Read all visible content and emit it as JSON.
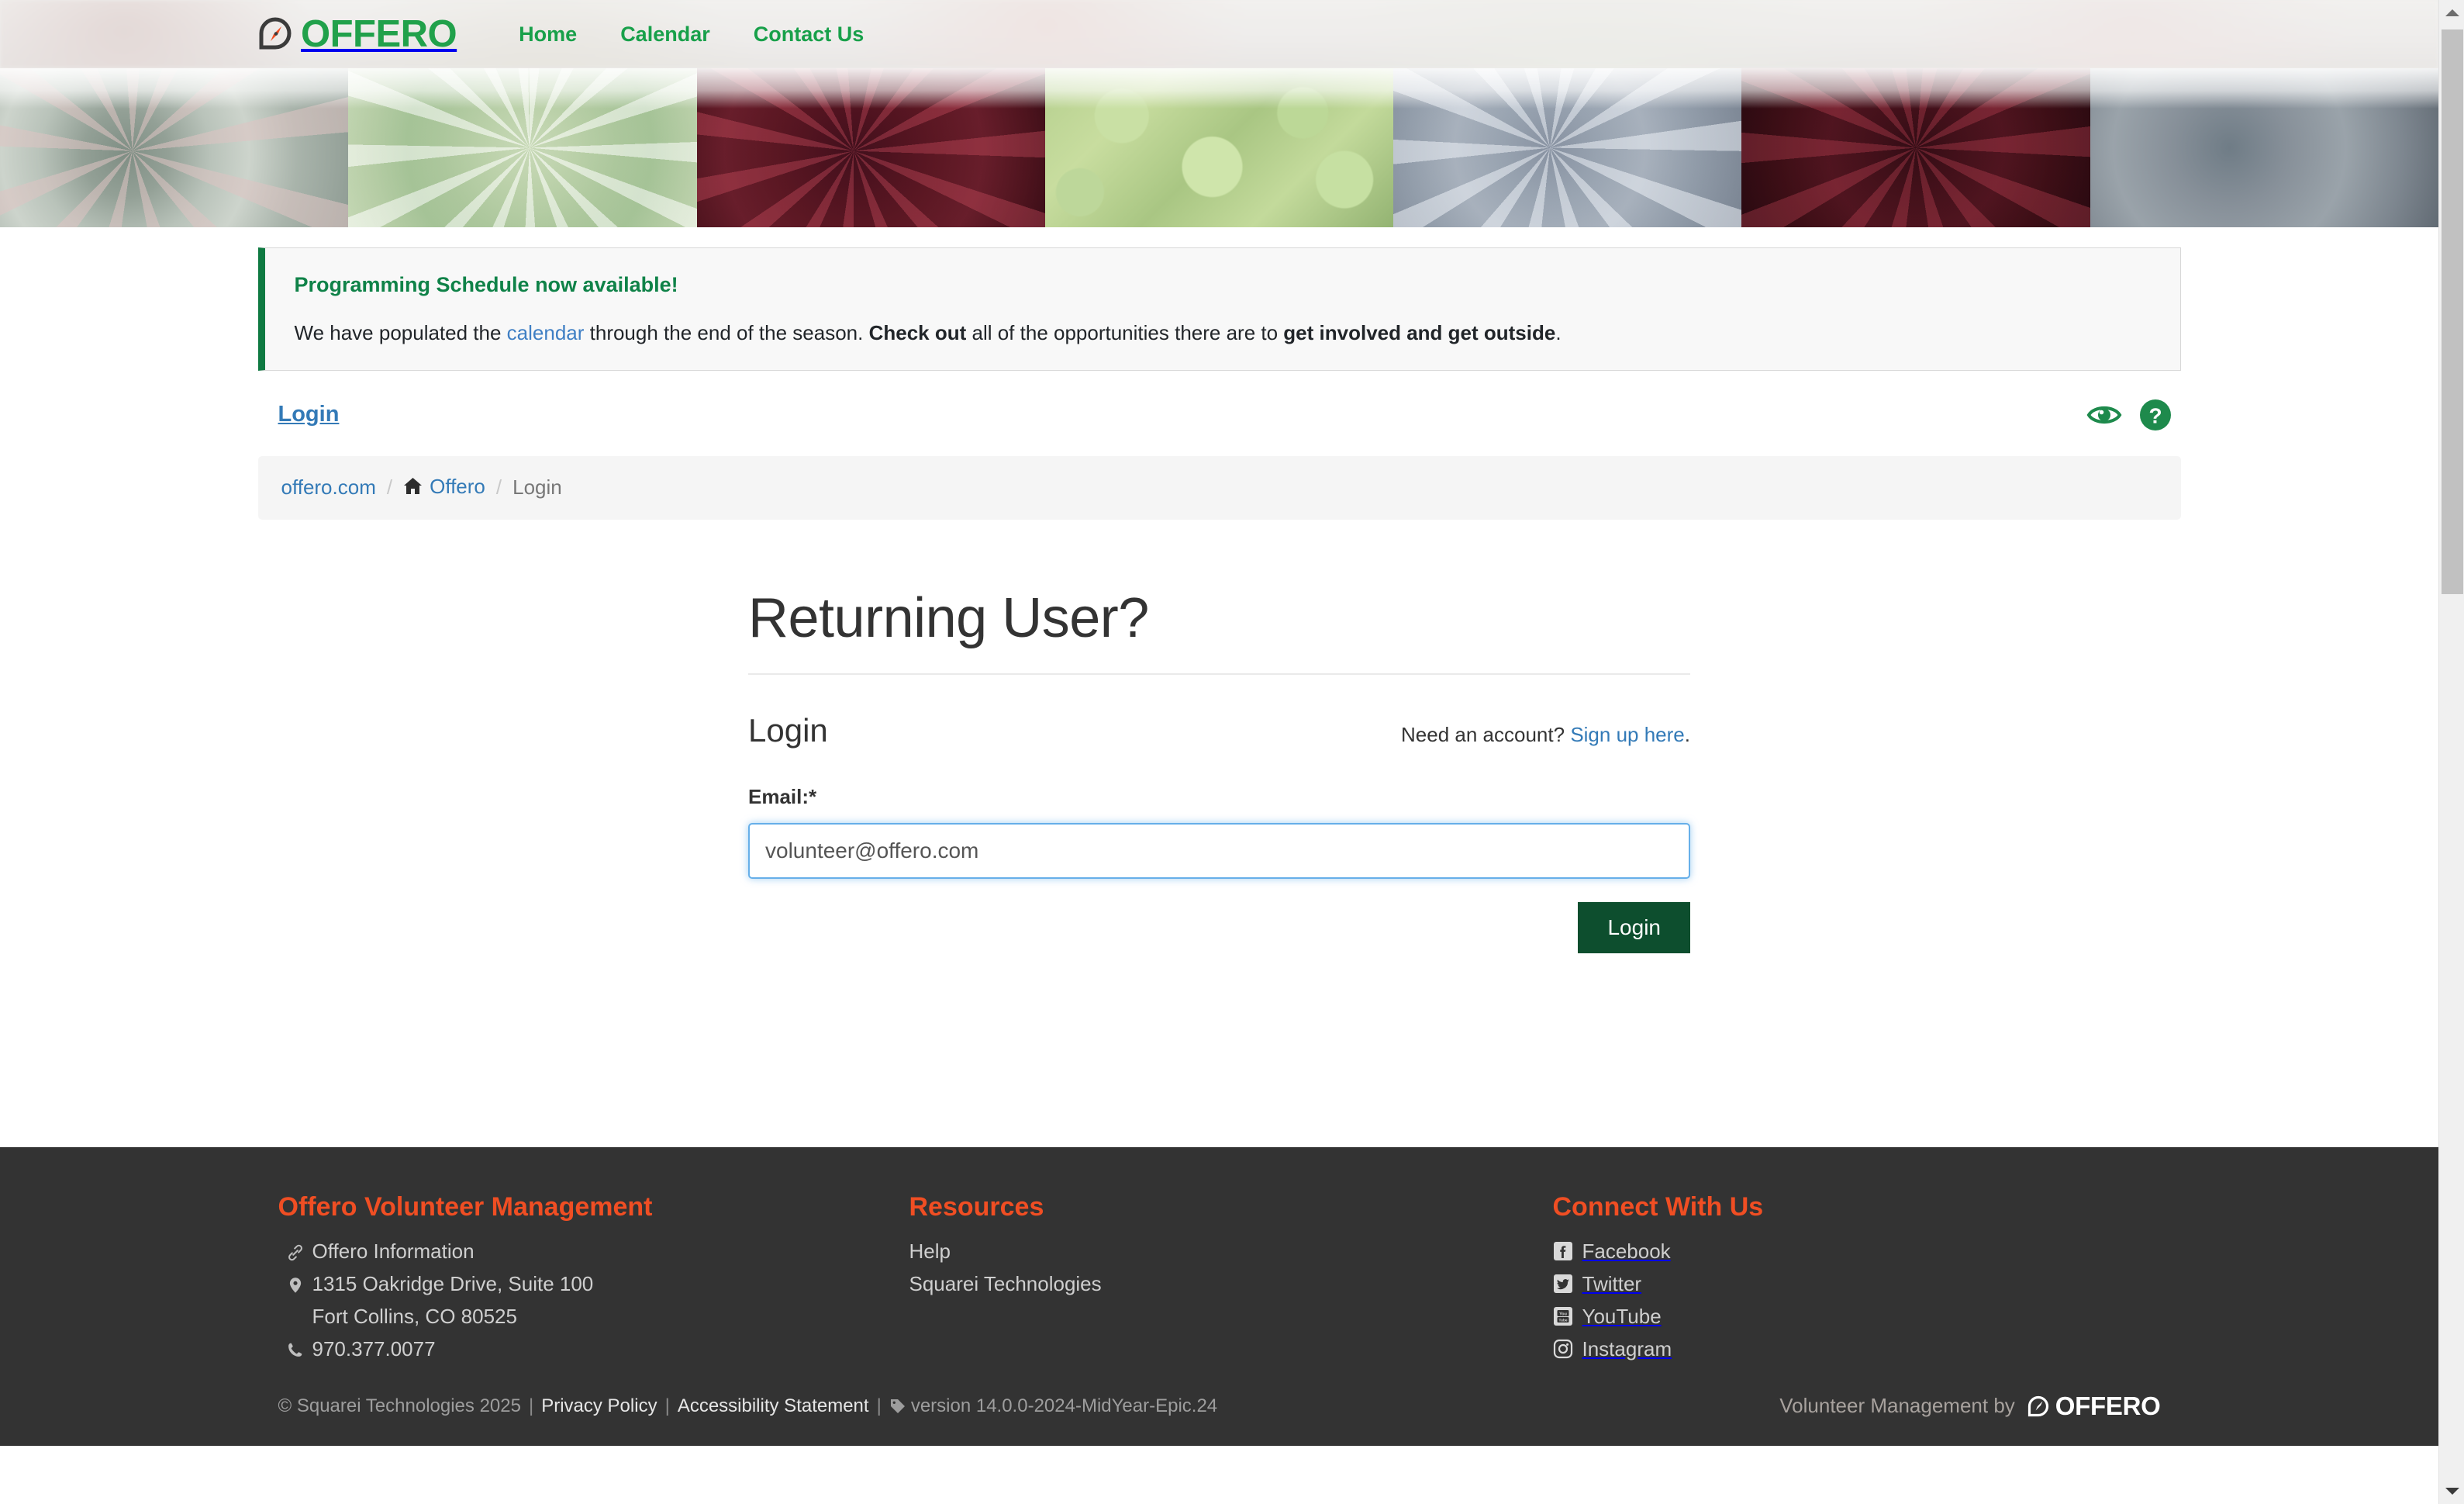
{
  "brand": {
    "name": "OFFERO",
    "logo_icon": "offero-compass-logo"
  },
  "nav": {
    "links": [
      {
        "label": "Home",
        "name": "nav-link-home"
      },
      {
        "label": "Calendar",
        "name": "nav-link-calendar"
      },
      {
        "label": "Contact Us",
        "name": "nav-link-contact-us"
      }
    ]
  },
  "alert": {
    "title": "Programming Schedule now available!",
    "body_1": "We have populated the ",
    "link": "calendar",
    "body_2": " through the end of the season. ",
    "bold_1": "Check out",
    "body_3": " all of the opportunities there are to ",
    "bold_2": "get involved and get outside",
    "body_4": "."
  },
  "pagehead": {
    "title": "Login",
    "icons": [
      {
        "name": "accessibility-eye-icon",
        "label": "Accessibility view"
      },
      {
        "name": "help-question-icon",
        "label": "Help"
      }
    ]
  },
  "breadcrumb": {
    "items": [
      {
        "label": "offero.com",
        "link": true,
        "icon": null
      },
      {
        "label": "Offero",
        "link": true,
        "icon": "home-icon"
      },
      {
        "label": "Login",
        "link": false,
        "icon": null
      }
    ],
    "separator": "/"
  },
  "main": {
    "heading": "Returning User?",
    "legend": "Login",
    "signup_prefix": "Need an account? ",
    "signup_link": "Sign up here",
    "signup_suffix": ".",
    "email_label": "Email:*",
    "email_value": "volunteer@offero.com",
    "email_placeholder": "",
    "submit_label": "Login"
  },
  "footer": {
    "col1": {
      "heading": "Offero Volunteer Management",
      "items": [
        {
          "icon": "link-icon",
          "text": "Offero Information"
        },
        {
          "icon": "map-pin-icon",
          "text": "1315 Oakridge Drive, Suite 100"
        },
        {
          "icon": null,
          "text": "Fort Collins, CO 80525"
        },
        {
          "icon": "phone-icon",
          "text": "970.377.0077"
        }
      ]
    },
    "col2": {
      "heading": "Resources",
      "links": [
        "Help",
        "Squarei Technologies"
      ]
    },
    "col3": {
      "heading": "Connect With Us",
      "socials": [
        {
          "icon": "facebook-icon",
          "label": "Facebook"
        },
        {
          "icon": "twitter-icon",
          "label": "Twitter"
        },
        {
          "icon": "youtube-icon",
          "label": "YouTube"
        },
        {
          "icon": "instagram-icon",
          "label": "Instagram"
        }
      ]
    },
    "bottom": {
      "copyright": "© Squarei Technologies 2025",
      "privacy": "Privacy Policy",
      "accessibility": "Accessibility Statement",
      "version": "version 14.0.0-2024-MidYear-Epic.24",
      "separator": "|",
      "attribution": "Volunteer Management by",
      "attribution_brand": "OFFERO"
    }
  },
  "colors": {
    "brand_green": "#21a14b",
    "nav_green": "#18a04a",
    "alert_green": "#0f8248",
    "link_blue": "#337ab7",
    "button_green": "#0d4e2e",
    "footer_bg": "#333333",
    "footer_heading_orange": "#f04e23",
    "input_focus_blue": "#66afe9"
  }
}
